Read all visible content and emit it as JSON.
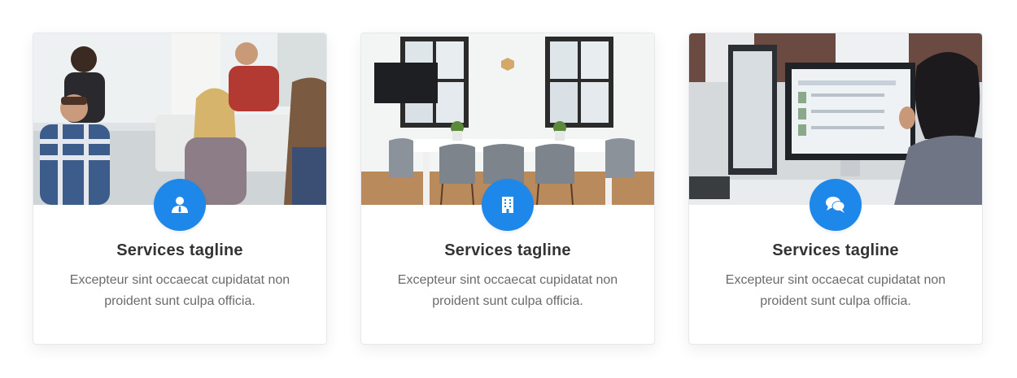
{
  "accent_color": "#1d87ea",
  "cards": [
    {
      "title": "Services tagline",
      "description": "Excepteur sint occaecat cupidatat non proident sunt culpa officia.",
      "icon": "user-icon",
      "photo": "team-meeting-photo"
    },
    {
      "title": "Services tagline",
      "description": "Excepteur sint occaecat cupidatat non proident sunt culpa officia.",
      "icon": "building-icon",
      "photo": "conference-room-photo"
    },
    {
      "title": "Services tagline",
      "description": "Excepteur sint occaecat cupidatat non proident sunt culpa officia.",
      "icon": "chat-icon",
      "photo": "developer-desk-photo"
    }
  ]
}
